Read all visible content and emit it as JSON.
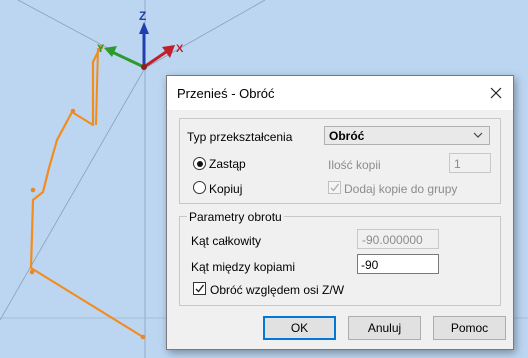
{
  "viewport": {
    "axis_z": "Z",
    "axis_y": "Y",
    "axis_x": "X"
  },
  "dialog": {
    "title": "Przenieś - Obróć",
    "transform_type_label": "Typ przekształcenia",
    "transform_type_value": "Obróć",
    "replace_label": "Zastąp",
    "replace_checked": true,
    "copy_label": "Kopiuj",
    "copy_checked": false,
    "copies_count_label": "Ilość kopii",
    "copies_count_value": "1",
    "add_copies_label": "Dodaj kopie do grupy",
    "add_copies_checked": true,
    "rotation_group_label": "Parametry obrotu",
    "total_angle_label": "Kąt całkowity",
    "total_angle_value": "-90.000000",
    "angle_between_label": "Kąt między kopiami",
    "angle_between_value": "-90",
    "rotate_about_label": "Obróć względem osi Z/W",
    "rotate_about_checked": true,
    "ok_label": "OK",
    "cancel_label": "Anuluj",
    "help_label": "Pomoc"
  },
  "colors": {
    "background": "#bcd6f2",
    "pipe": "#f28c1e",
    "axis_z": "#1f3fb0",
    "axis_y": "#2e9a2e",
    "axis_x": "#c0202a",
    "accent": "#0078d7"
  }
}
